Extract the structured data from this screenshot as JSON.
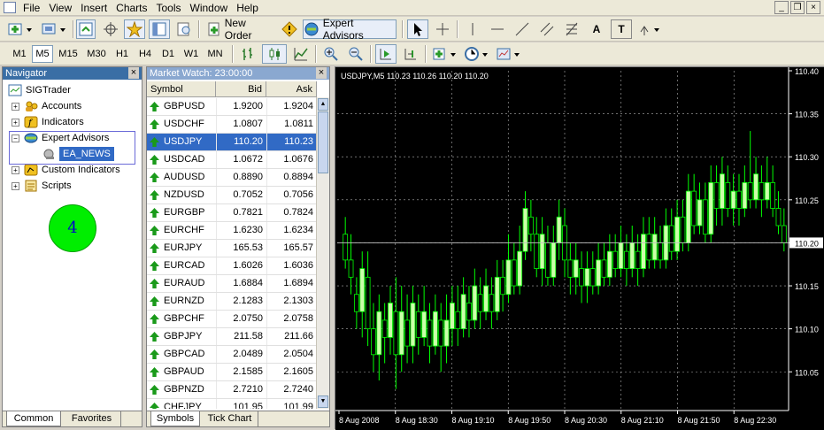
{
  "menu": {
    "items": [
      "File",
      "View",
      "Insert",
      "Charts",
      "Tools",
      "Window",
      "Help"
    ],
    "window_buttons": [
      "_",
      "❐",
      "×"
    ]
  },
  "toolbar1": {
    "new_order_label": "New Order",
    "expert_advisors_label": "Expert Advisors",
    "text_tool_label": "A",
    "text_label_tool": "T"
  },
  "timeframes": [
    "M1",
    "M5",
    "M15",
    "M30",
    "H1",
    "H4",
    "D1",
    "W1",
    "MN"
  ],
  "active_timeframe": "M5",
  "navigator": {
    "title": "Navigator",
    "close": "×",
    "root": "SIGTrader",
    "nodes": [
      "Accounts",
      "Indicators",
      "Expert Advisors",
      "Custom Indicators",
      "Scripts"
    ],
    "expert_child": "EA_NEWS",
    "badge_number": "4",
    "tabs": [
      "Common",
      "Favorites"
    ]
  },
  "market_watch": {
    "title": "Market Watch: 23:00:00",
    "close": "×",
    "columns": [
      "Symbol",
      "Bid",
      "Ask"
    ],
    "selected_symbol": "USDJPY",
    "rows": [
      [
        "GBPUSD",
        "1.9200",
        "1.9204"
      ],
      [
        "USDCHF",
        "1.0807",
        "1.0811"
      ],
      [
        "USDJPY",
        "110.20",
        "110.23"
      ],
      [
        "USDCAD",
        "1.0672",
        "1.0676"
      ],
      [
        "AUDUSD",
        "0.8890",
        "0.8894"
      ],
      [
        "NZDUSD",
        "0.7052",
        "0.7056"
      ],
      [
        "EURGBP",
        "0.7821",
        "0.7824"
      ],
      [
        "EURCHF",
        "1.6230",
        "1.6234"
      ],
      [
        "EURJPY",
        "165.53",
        "165.57"
      ],
      [
        "EURCAD",
        "1.6026",
        "1.6036"
      ],
      [
        "EURAUD",
        "1.6884",
        "1.6894"
      ],
      [
        "EURNZD",
        "2.1283",
        "2.1303"
      ],
      [
        "GBPCHF",
        "2.0750",
        "2.0758"
      ],
      [
        "GBPJPY",
        "211.58",
        "211.66"
      ],
      [
        "GBPCAD",
        "2.0489",
        "2.0504"
      ],
      [
        "GBPAUD",
        "2.1585",
        "2.1605"
      ],
      [
        "GBPNZD",
        "2.7210",
        "2.7240"
      ],
      [
        "CHFJPY",
        "101.95",
        "101.99"
      ]
    ],
    "tabs": [
      "Symbols",
      "Tick Chart"
    ]
  },
  "chart": {
    "header": "USDJPY,M5  110.23 110.26 110.20 110.20",
    "y_labels": [
      "110.40",
      "110.35",
      "110.30",
      "110.25",
      "110.20",
      "110.15",
      "110.10",
      "110.05"
    ],
    "current_price_label": "110.20",
    "current_price": 110.2,
    "x_labels": [
      "8 Aug 2008",
      "8 Aug 18:30",
      "8 Aug 19:10",
      "8 Aug 19:50",
      "8 Aug 20:30",
      "8 Aug 21:10",
      "8 Aug 21:50",
      "8 Aug 22:30"
    ],
    "y_range": [
      110.005,
      110.4
    ],
    "colors": {
      "background": "#000000",
      "up_candle": "#ccffaa",
      "wick": "#00ff00",
      "grid": "#b0b0b0",
      "text": "#ffffff"
    },
    "candles": [
      [
        110.21,
        110.18,
        110.23,
        110.17
      ],
      [
        110.18,
        110.16,
        110.21,
        110.14
      ],
      [
        110.14,
        110.12,
        110.16,
        110.1
      ],
      [
        110.12,
        110.17,
        110.19,
        110.09
      ],
      [
        110.16,
        110.1,
        110.19,
        110.08
      ],
      [
        110.1,
        110.07,
        110.13,
        110.05
      ],
      [
        110.07,
        110.12,
        110.14,
        110.04
      ],
      [
        110.11,
        110.09,
        110.13,
        110.06
      ],
      [
        110.09,
        110.13,
        110.15,
        110.07
      ],
      [
        110.12,
        110.07,
        110.16,
        110.03
      ],
      [
        110.07,
        110.12,
        110.15,
        110.05
      ],
      [
        110.11,
        110.08,
        110.14,
        110.06
      ],
      [
        110.08,
        110.13,
        110.15,
        110.06
      ],
      [
        110.12,
        110.09,
        110.14,
        110.07
      ],
      [
        110.09,
        110.12,
        110.15,
        110.08
      ],
      [
        110.11,
        110.08,
        110.13,
        110.06
      ],
      [
        110.08,
        110.12,
        110.14,
        110.07
      ],
      [
        110.11,
        110.08,
        110.13,
        110.05
      ],
      [
        110.08,
        110.11,
        110.14,
        110.06
      ],
      [
        110.1,
        110.13,
        110.15,
        110.08
      ],
      [
        110.12,
        110.1,
        110.15,
        110.08
      ],
      [
        110.1,
        110.14,
        110.16,
        110.09
      ],
      [
        110.13,
        110.11,
        110.15,
        110.09
      ],
      [
        110.11,
        110.15,
        110.17,
        110.1
      ],
      [
        110.14,
        110.12,
        110.16,
        110.1
      ],
      [
        110.12,
        110.15,
        110.17,
        110.11
      ],
      [
        110.14,
        110.12,
        110.16,
        110.1
      ],
      [
        110.12,
        110.16,
        110.18,
        110.11
      ],
      [
        110.16,
        110.14,
        110.18,
        110.12
      ],
      [
        110.14,
        110.18,
        110.21,
        110.13
      ],
      [
        110.18,
        110.15,
        110.2,
        110.14
      ],
      [
        110.15,
        110.19,
        110.22,
        110.14
      ],
      [
        110.19,
        110.24,
        110.26,
        110.18
      ],
      [
        110.23,
        110.21,
        110.25,
        110.19
      ],
      [
        110.21,
        110.17,
        110.23,
        110.16
      ],
      [
        110.17,
        110.21,
        110.23,
        110.15
      ],
      [
        110.2,
        110.16,
        110.22,
        110.15
      ],
      [
        110.16,
        110.2,
        110.22,
        110.15
      ],
      [
        110.2,
        110.23,
        110.25,
        110.18
      ],
      [
        110.22,
        110.18,
        110.24,
        110.16
      ],
      [
        110.18,
        110.16,
        110.2,
        110.14
      ],
      [
        110.16,
        110.18,
        110.2,
        110.14
      ],
      [
        110.17,
        110.15,
        110.19,
        110.13
      ],
      [
        110.15,
        110.17,
        110.19,
        110.13
      ],
      [
        110.17,
        110.15,
        110.19,
        110.14
      ],
      [
        110.15,
        110.18,
        110.2,
        110.14
      ],
      [
        110.18,
        110.16,
        110.2,
        110.15
      ],
      [
        110.16,
        110.19,
        110.21,
        110.15
      ],
      [
        110.19,
        110.17,
        110.21,
        110.16
      ],
      [
        110.17,
        110.2,
        110.22,
        110.16
      ],
      [
        110.19,
        110.17,
        110.21,
        110.15
      ],
      [
        110.17,
        110.2,
        110.22,
        110.16
      ],
      [
        110.19,
        110.17,
        110.21,
        110.15
      ],
      [
        110.17,
        110.21,
        110.23,
        110.16
      ],
      [
        110.21,
        110.18,
        110.23,
        110.17
      ],
      [
        110.18,
        110.21,
        110.23,
        110.17
      ],
      [
        110.2,
        110.18,
        110.22,
        110.17
      ],
      [
        110.18,
        110.22,
        110.24,
        110.17
      ],
      [
        110.22,
        110.19,
        110.24,
        110.18
      ],
      [
        110.19,
        110.23,
        110.25,
        110.18
      ],
      [
        110.23,
        110.2,
        110.25,
        110.19
      ],
      [
        110.2,
        110.26,
        110.28,
        110.19
      ],
      [
        110.26,
        110.22,
        110.28,
        110.21
      ],
      [
        110.22,
        110.25,
        110.27,
        110.21
      ],
      [
        110.25,
        110.21,
        110.27,
        110.2
      ],
      [
        110.21,
        110.27,
        110.29,
        110.2
      ],
      [
        110.27,
        110.24,
        110.29,
        110.22
      ],
      [
        110.24,
        110.28,
        110.3,
        110.22
      ],
      [
        110.27,
        110.24,
        110.29,
        110.23
      ],
      [
        110.24,
        110.26,
        110.28,
        110.22
      ],
      [
        110.26,
        110.24,
        110.28,
        110.22
      ],
      [
        110.24,
        110.27,
        110.29,
        110.23
      ],
      [
        110.27,
        110.25,
        110.33,
        110.24
      ],
      [
        110.25,
        110.28,
        110.3,
        110.24
      ],
      [
        110.27,
        110.25,
        110.29,
        110.23
      ],
      [
        110.25,
        110.27,
        110.3,
        110.24
      ],
      [
        110.27,
        110.24,
        110.29,
        110.23
      ],
      [
        110.24,
        110.22,
        110.26,
        110.21
      ],
      [
        110.22,
        110.2,
        110.24,
        110.19
      ]
    ]
  }
}
